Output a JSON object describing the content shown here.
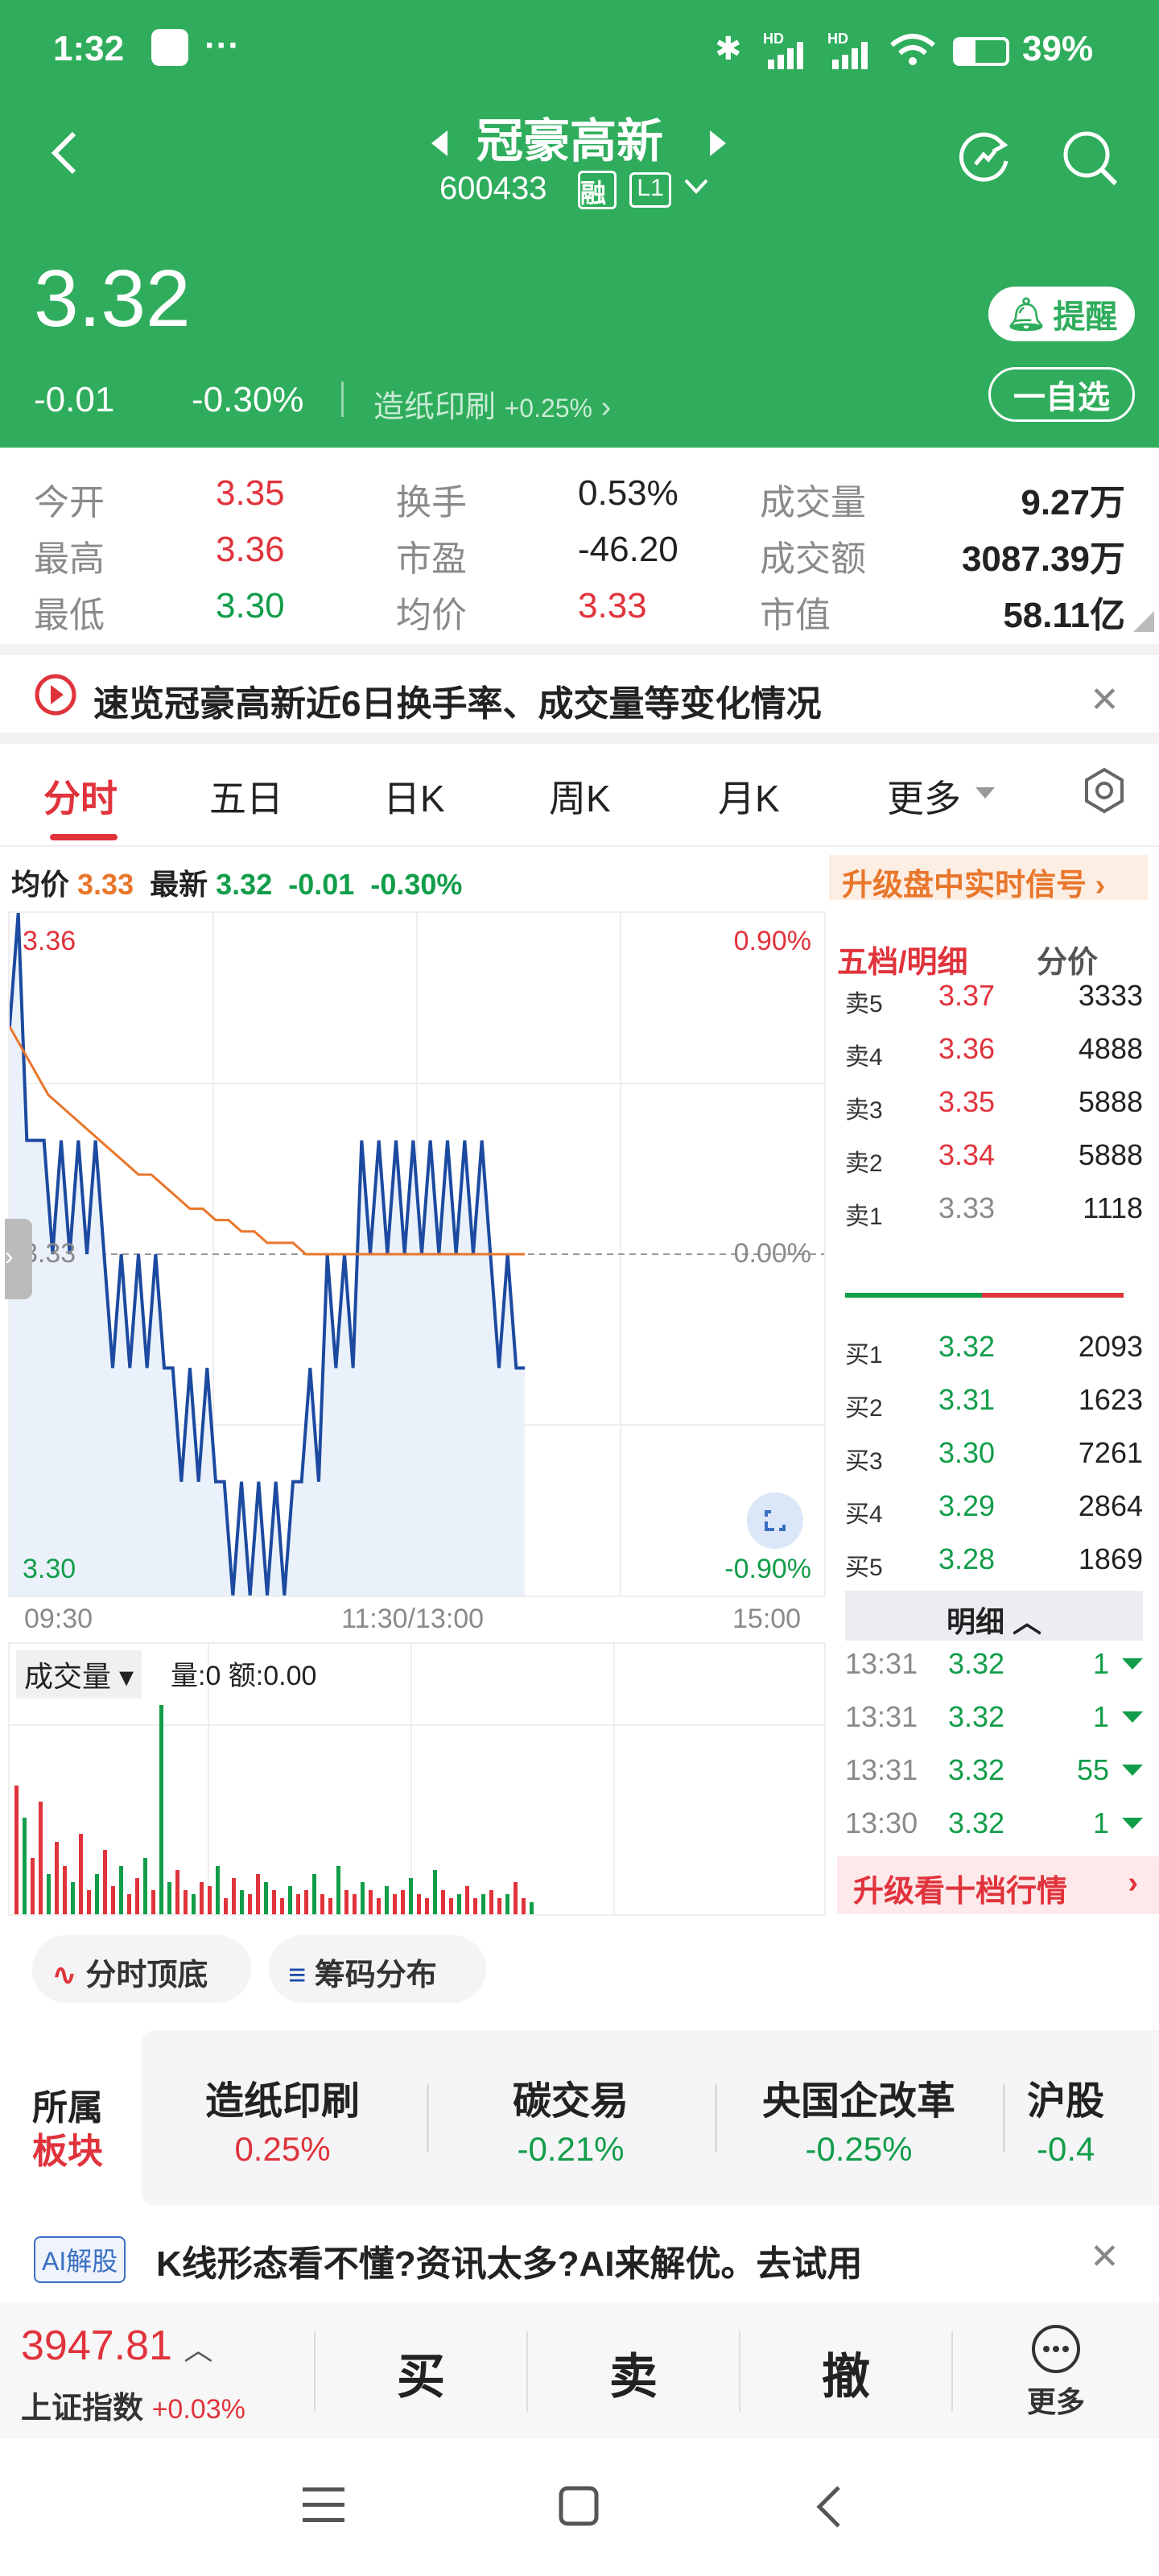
{
  "status_bar": {
    "time": "1:32",
    "dots": "···",
    "battery": "39%",
    "net1": "HD",
    "net2": "HD"
  },
  "header": {
    "title": "冠豪高新",
    "code": "600433",
    "badge_rong": "融",
    "badge_level": "L1",
    "price": "3.32",
    "change": "-0.01",
    "change_pct": "-0.30%",
    "sector": "造纸印刷",
    "sector_pct": "+0.25%",
    "remind_label": "提醒",
    "watch_label": "自选",
    "watch_prefix": "一"
  },
  "quote": {
    "rows": [
      {
        "l1": "今开",
        "v1": "3.35",
        "l2": "换手",
        "v2": "0.53%",
        "l3": "成交量",
        "v3": "9.27万"
      },
      {
        "l1": "最高",
        "v1": "3.36",
        "l2": "市盈",
        "v2": "-46.20",
        "l3": "成交额",
        "v3": "3087.39万"
      },
      {
        "l1": "最低",
        "v1": "3.30",
        "l2": "均价",
        "v2": "3.33",
        "l3": "市值",
        "v3": "58.11亿"
      }
    ]
  },
  "banner": {
    "text": "速览冠豪高新近6日换手率、成交量等变化情况"
  },
  "tabs": [
    "分时",
    "五日",
    "日K",
    "周K",
    "月K",
    "更多"
  ],
  "chart_info": {
    "avg_label": "均价",
    "avg": "3.33",
    "last_label": "最新",
    "last": "3.32",
    "chg": "-0.01",
    "chg_pct": "-0.30%",
    "upgrade": "升级盘中实时信号"
  },
  "chart_data": {
    "type": "line",
    "y_left_top": "3.36",
    "y_left_mid": "3.33",
    "y_left_bot": "3.30",
    "y_right_top": "0.90%",
    "y_right_mid": "0.00%",
    "y_right_bot": "-0.90%",
    "x_ticks": [
      "09:30",
      "11:30/13:00",
      "15:00"
    ],
    "ylim": [
      3.3,
      3.36
    ],
    "prev_close": 3.33,
    "series": [
      {
        "values": [
          3.35,
          3.36,
          3.34,
          3.34,
          3.34,
          3.33,
          3.34,
          3.33,
          3.34,
          3.33,
          3.34,
          3.33,
          3.32,
          3.33,
          3.32,
          3.33,
          3.32,
          3.33,
          3.32,
          3.32,
          3.31,
          3.32,
          3.31,
          3.32,
          3.31,
          3.31,
          3.3,
          3.31,
          3.3,
          3.31,
          3.3,
          3.31,
          3.3,
          3.31,
          3.31,
          3.32,
          3.31,
          3.33,
          3.32,
          3.33,
          3.32,
          3.34,
          3.33,
          3.34,
          3.33,
          3.34,
          3.33,
          3.34,
          3.33,
          3.34,
          3.33,
          3.34,
          3.33,
          3.34,
          3.33,
          3.34,
          3.33,
          3.32,
          3.33,
          3.32,
          3.32
        ]
      },
      {
        "values": [
          3.35,
          3.348,
          3.346,
          3.344,
          3.343,
          3.342,
          3.341,
          3.34,
          3.339,
          3.338,
          3.337,
          3.337,
          3.336,
          3.335,
          3.334,
          3.334,
          3.333,
          3.333,
          3.332,
          3.332,
          3.331,
          3.331,
          3.331,
          3.33,
          3.33,
          3.33,
          3.33,
          3.33,
          3.33,
          3.33,
          3.33,
          3.33,
          3.33,
          3.33,
          3.33,
          3.33,
          3.33,
          3.33,
          3.33,
          3.33,
          3.33
        ]
      }
    ],
    "volume_label": "成交量",
    "volume_info": "量:0 额:0.00"
  },
  "orderbook": {
    "head1": "五档/明细",
    "head2": "分价",
    "asks": [
      {
        "l": "卖5",
        "p": "3.37",
        "v": "3333"
      },
      {
        "l": "卖4",
        "p": "3.36",
        "v": "4888"
      },
      {
        "l": "卖3",
        "p": "3.35",
        "v": "5888"
      },
      {
        "l": "卖2",
        "p": "3.34",
        "v": "5888"
      },
      {
        "l": "卖1",
        "p": "3.33",
        "v": "1118"
      }
    ],
    "bids": [
      {
        "l": "买1",
        "p": "3.32",
        "v": "2093"
      },
      {
        "l": "买2",
        "p": "3.31",
        "v": "1623"
      },
      {
        "l": "买3",
        "p": "3.30",
        "v": "7261"
      },
      {
        "l": "买4",
        "p": "3.29",
        "v": "2864"
      },
      {
        "l": "买5",
        "p": "3.28",
        "v": "1869"
      }
    ],
    "detail_label": "明细",
    "ticks": [
      {
        "t": "13:31",
        "p": "3.32",
        "v": "1"
      },
      {
        "t": "13:31",
        "p": "3.32",
        "v": "1"
      },
      {
        "t": "13:31",
        "p": "3.32",
        "v": "55"
      },
      {
        "t": "13:30",
        "p": "3.32",
        "v": "1"
      }
    ],
    "upgrade10": "升级看十档行情"
  },
  "tools": {
    "b1": "分时顶底",
    "b2": "筹码分布"
  },
  "sectors": {
    "label1": "所属",
    "label2": "板块",
    "items": [
      {
        "n": "造纸印刷",
        "p": "0.25%"
      },
      {
        "n": "碳交易",
        "p": "-0.21%"
      },
      {
        "n": "央国企改革",
        "p": "-0.25%"
      },
      {
        "n": "沪股",
        "p": "-0.4"
      }
    ]
  },
  "ai": {
    "badge": "AI解股",
    "text": "K线形态看不懂?资讯太多?AI来解优。去试用"
  },
  "bottom": {
    "index_val": "3947.81",
    "index_name": "上证指数",
    "index_pct": "+0.03%",
    "buy": "买",
    "sell": "卖",
    "cancel": "撤",
    "more": "更多"
  }
}
